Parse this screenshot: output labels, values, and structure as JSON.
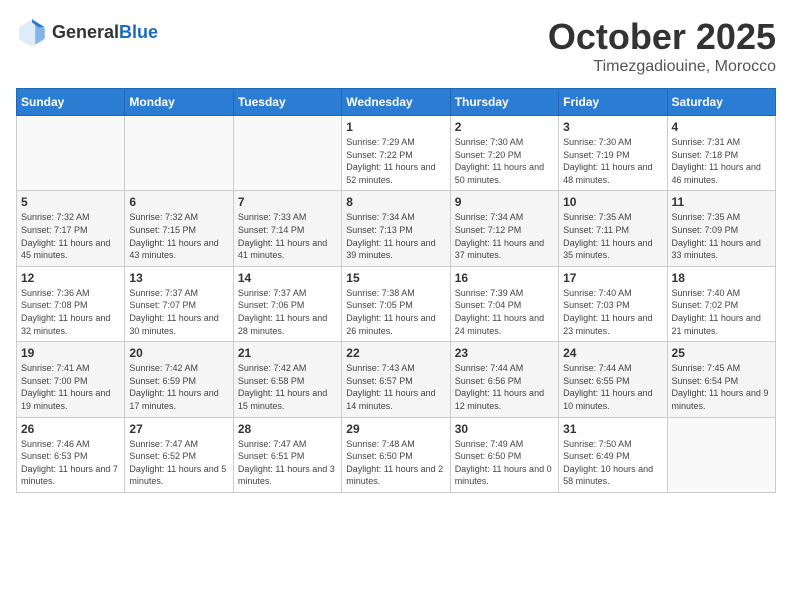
{
  "header": {
    "logo_general": "General",
    "logo_blue": "Blue",
    "month": "October 2025",
    "location": "Timezgadiouine, Morocco"
  },
  "days_of_week": [
    "Sunday",
    "Monday",
    "Tuesday",
    "Wednesday",
    "Thursday",
    "Friday",
    "Saturday"
  ],
  "weeks": [
    [
      null,
      null,
      null,
      {
        "day": 1,
        "sunrise": "Sunrise: 7:29 AM",
        "sunset": "Sunset: 7:22 PM",
        "daylight": "Daylight: 11 hours and 52 minutes."
      },
      {
        "day": 2,
        "sunrise": "Sunrise: 7:30 AM",
        "sunset": "Sunset: 7:20 PM",
        "daylight": "Daylight: 11 hours and 50 minutes."
      },
      {
        "day": 3,
        "sunrise": "Sunrise: 7:30 AM",
        "sunset": "Sunset: 7:19 PM",
        "daylight": "Daylight: 11 hours and 48 minutes."
      },
      {
        "day": 4,
        "sunrise": "Sunrise: 7:31 AM",
        "sunset": "Sunset: 7:18 PM",
        "daylight": "Daylight: 11 hours and 46 minutes."
      }
    ],
    [
      {
        "day": 5,
        "sunrise": "Sunrise: 7:32 AM",
        "sunset": "Sunset: 7:17 PM",
        "daylight": "Daylight: 11 hours and 45 minutes."
      },
      {
        "day": 6,
        "sunrise": "Sunrise: 7:32 AM",
        "sunset": "Sunset: 7:15 PM",
        "daylight": "Daylight: 11 hours and 43 minutes."
      },
      {
        "day": 7,
        "sunrise": "Sunrise: 7:33 AM",
        "sunset": "Sunset: 7:14 PM",
        "daylight": "Daylight: 11 hours and 41 minutes."
      },
      {
        "day": 8,
        "sunrise": "Sunrise: 7:34 AM",
        "sunset": "Sunset: 7:13 PM",
        "daylight": "Daylight: 11 hours and 39 minutes."
      },
      {
        "day": 9,
        "sunrise": "Sunrise: 7:34 AM",
        "sunset": "Sunset: 7:12 PM",
        "daylight": "Daylight: 11 hours and 37 minutes."
      },
      {
        "day": 10,
        "sunrise": "Sunrise: 7:35 AM",
        "sunset": "Sunset: 7:11 PM",
        "daylight": "Daylight: 11 hours and 35 minutes."
      },
      {
        "day": 11,
        "sunrise": "Sunrise: 7:35 AM",
        "sunset": "Sunset: 7:09 PM",
        "daylight": "Daylight: 11 hours and 33 minutes."
      }
    ],
    [
      {
        "day": 12,
        "sunrise": "Sunrise: 7:36 AM",
        "sunset": "Sunset: 7:08 PM",
        "daylight": "Daylight: 11 hours and 32 minutes."
      },
      {
        "day": 13,
        "sunrise": "Sunrise: 7:37 AM",
        "sunset": "Sunset: 7:07 PM",
        "daylight": "Daylight: 11 hours and 30 minutes."
      },
      {
        "day": 14,
        "sunrise": "Sunrise: 7:37 AM",
        "sunset": "Sunset: 7:06 PM",
        "daylight": "Daylight: 11 hours and 28 minutes."
      },
      {
        "day": 15,
        "sunrise": "Sunrise: 7:38 AM",
        "sunset": "Sunset: 7:05 PM",
        "daylight": "Daylight: 11 hours and 26 minutes."
      },
      {
        "day": 16,
        "sunrise": "Sunrise: 7:39 AM",
        "sunset": "Sunset: 7:04 PM",
        "daylight": "Daylight: 11 hours and 24 minutes."
      },
      {
        "day": 17,
        "sunrise": "Sunrise: 7:40 AM",
        "sunset": "Sunset: 7:03 PM",
        "daylight": "Daylight: 11 hours and 23 minutes."
      },
      {
        "day": 18,
        "sunrise": "Sunrise: 7:40 AM",
        "sunset": "Sunset: 7:02 PM",
        "daylight": "Daylight: 11 hours and 21 minutes."
      }
    ],
    [
      {
        "day": 19,
        "sunrise": "Sunrise: 7:41 AM",
        "sunset": "Sunset: 7:00 PM",
        "daylight": "Daylight: 11 hours and 19 minutes."
      },
      {
        "day": 20,
        "sunrise": "Sunrise: 7:42 AM",
        "sunset": "Sunset: 6:59 PM",
        "daylight": "Daylight: 11 hours and 17 minutes."
      },
      {
        "day": 21,
        "sunrise": "Sunrise: 7:42 AM",
        "sunset": "Sunset: 6:58 PM",
        "daylight": "Daylight: 11 hours and 15 minutes."
      },
      {
        "day": 22,
        "sunrise": "Sunrise: 7:43 AM",
        "sunset": "Sunset: 6:57 PM",
        "daylight": "Daylight: 11 hours and 14 minutes."
      },
      {
        "day": 23,
        "sunrise": "Sunrise: 7:44 AM",
        "sunset": "Sunset: 6:56 PM",
        "daylight": "Daylight: 11 hours and 12 minutes."
      },
      {
        "day": 24,
        "sunrise": "Sunrise: 7:44 AM",
        "sunset": "Sunset: 6:55 PM",
        "daylight": "Daylight: 11 hours and 10 minutes."
      },
      {
        "day": 25,
        "sunrise": "Sunrise: 7:45 AM",
        "sunset": "Sunset: 6:54 PM",
        "daylight": "Daylight: 11 hours and 9 minutes."
      }
    ],
    [
      {
        "day": 26,
        "sunrise": "Sunrise: 7:46 AM",
        "sunset": "Sunset: 6:53 PM",
        "daylight": "Daylight: 11 hours and 7 minutes."
      },
      {
        "day": 27,
        "sunrise": "Sunrise: 7:47 AM",
        "sunset": "Sunset: 6:52 PM",
        "daylight": "Daylight: 11 hours and 5 minutes."
      },
      {
        "day": 28,
        "sunrise": "Sunrise: 7:47 AM",
        "sunset": "Sunset: 6:51 PM",
        "daylight": "Daylight: 11 hours and 3 minutes."
      },
      {
        "day": 29,
        "sunrise": "Sunrise: 7:48 AM",
        "sunset": "Sunset: 6:50 PM",
        "daylight": "Daylight: 11 hours and 2 minutes."
      },
      {
        "day": 30,
        "sunrise": "Sunrise: 7:49 AM",
        "sunset": "Sunset: 6:50 PM",
        "daylight": "Daylight: 11 hours and 0 minutes."
      },
      {
        "day": 31,
        "sunrise": "Sunrise: 7:50 AM",
        "sunset": "Sunset: 6:49 PM",
        "daylight": "Daylight: 10 hours and 58 minutes."
      },
      null
    ]
  ]
}
